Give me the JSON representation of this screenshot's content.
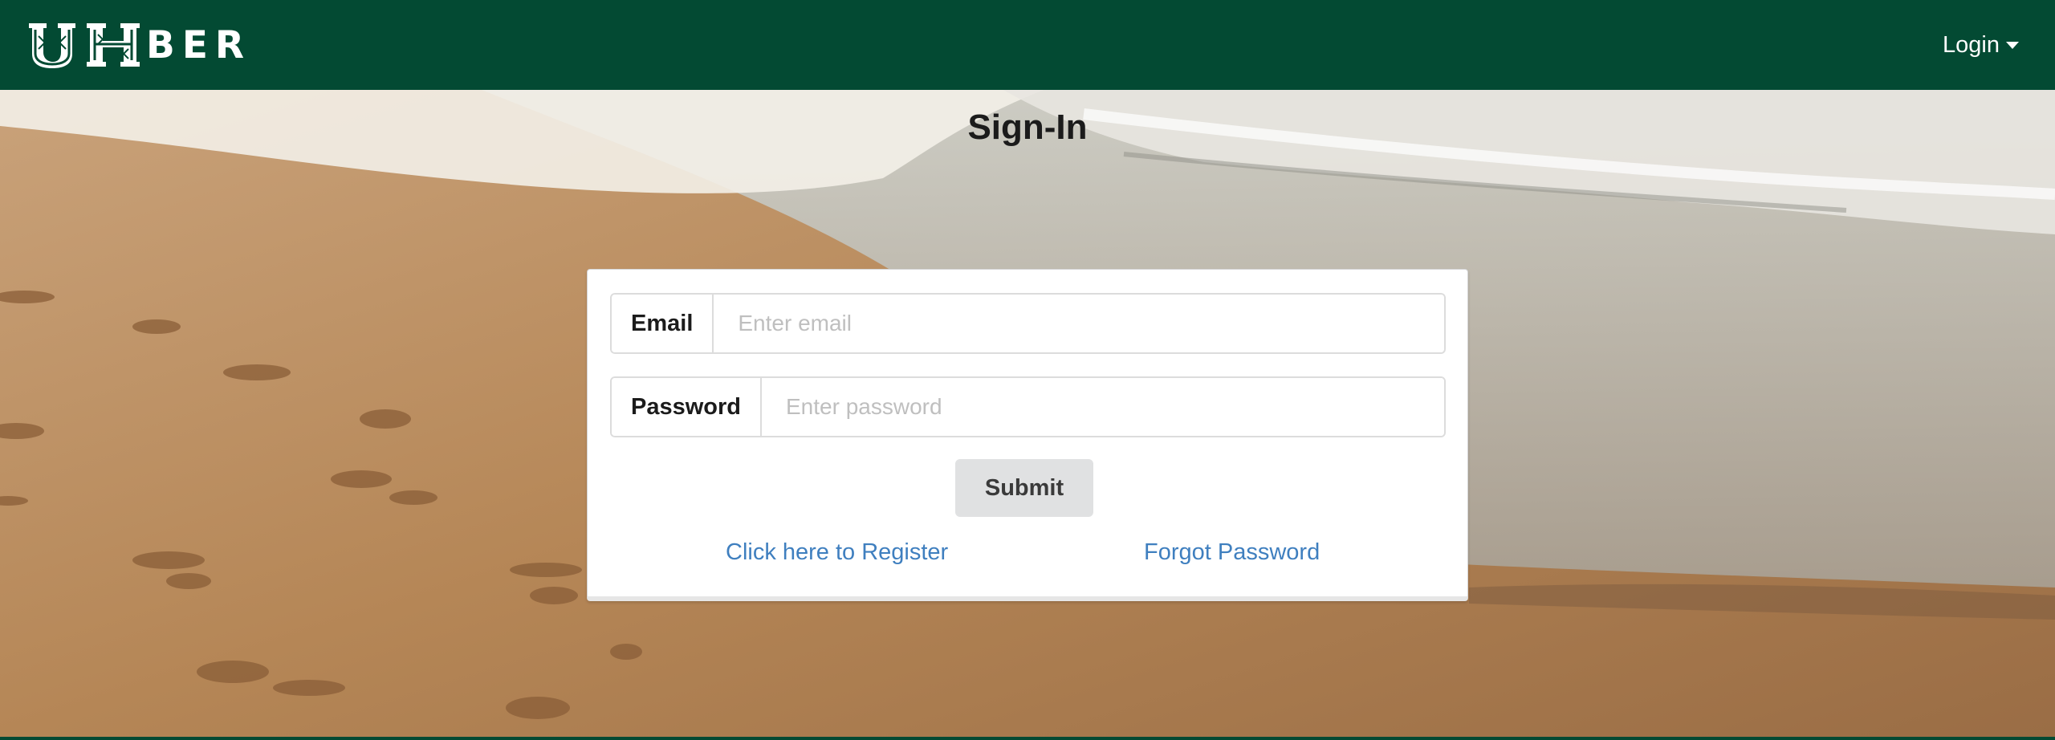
{
  "navbar": {
    "brand_text": "BER",
    "brand_mark": "UH",
    "login_label": "Login"
  },
  "page": {
    "title": "Sign-In"
  },
  "form": {
    "email_label": "Email",
    "email_placeholder": "Enter email",
    "email_value": "",
    "password_label": "Password",
    "password_placeholder": "Enter password",
    "password_value": "",
    "submit_label": "Submit",
    "register_link": "Click here to Register",
    "forgot_link": "Forgot Password"
  },
  "colors": {
    "navbar_bg": "#034a33",
    "link": "#3f7fbf",
    "button_bg": "#e0e1e2"
  },
  "icons": {
    "login_caret": "caret-down-icon"
  }
}
